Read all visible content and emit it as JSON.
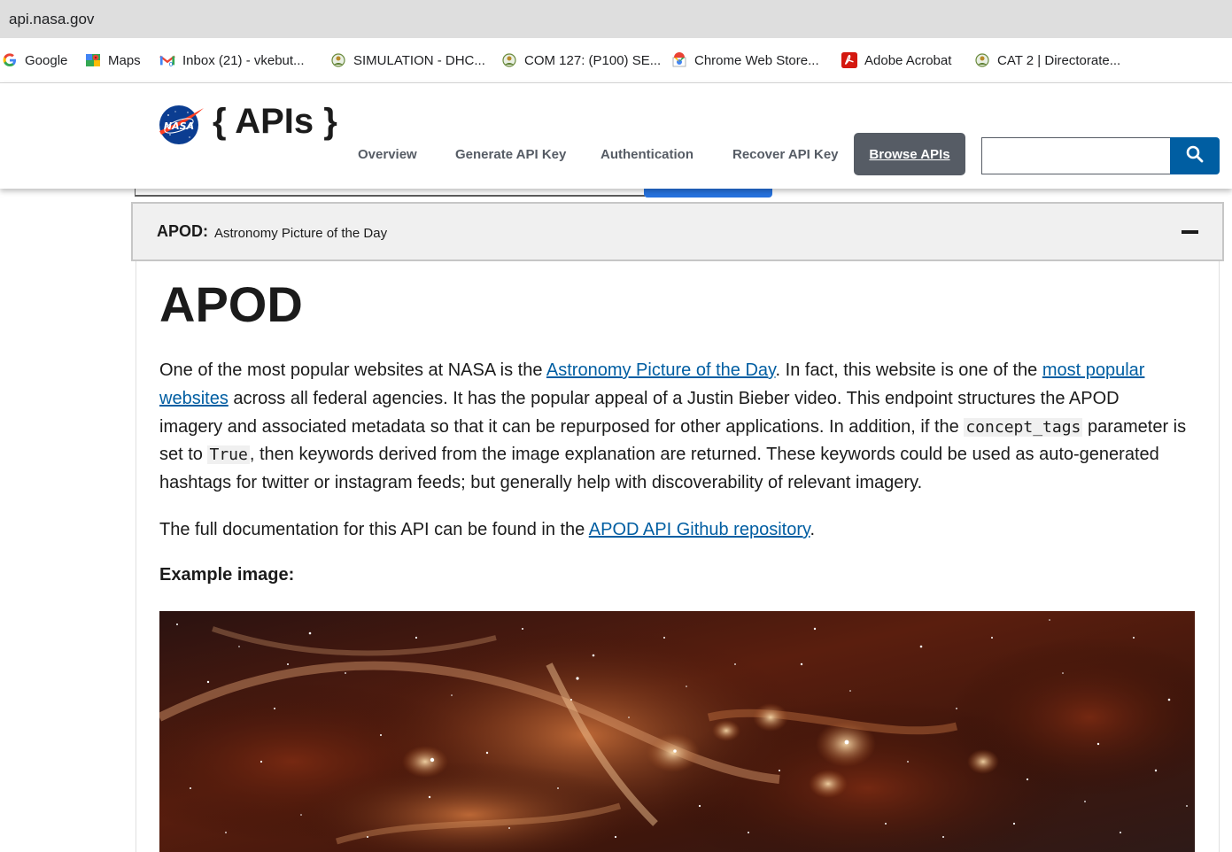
{
  "browser": {
    "url": "api.nasa.gov",
    "bookmarks": [
      {
        "label": "Google",
        "icon": "google-icon"
      },
      {
        "label": "Maps",
        "icon": "maps-icon"
      },
      {
        "label": "Inbox (21) - vkebut...",
        "icon": "gmail-icon"
      },
      {
        "label": "SIMULATION - DHC...",
        "icon": "site-badge-icon"
      },
      {
        "label": "COM 127: (P100) SE...",
        "icon": "site-badge-icon"
      },
      {
        "label": "Chrome Web Store...",
        "icon": "chrome-web-store-icon"
      },
      {
        "label": "Adobe Acrobat",
        "icon": "adobe-acrobat-icon"
      },
      {
        "label": "CAT 2 | Directorate...",
        "icon": "site-badge-icon"
      }
    ]
  },
  "header": {
    "title": "{ APIs }",
    "logo_text": "NASA",
    "nav": [
      "Overview",
      "Generate API Key",
      "Authentication",
      "Recover API Key"
    ],
    "browse_label": "Browse APIs",
    "search_value": ""
  },
  "accordion": {
    "label": "APOD:",
    "sublabel": "Astronomy Picture of the Day"
  },
  "article": {
    "heading": "APOD",
    "p1": {
      "t1": "One of the most popular websites at NASA is the ",
      "link1": "Astronomy Picture of the Day",
      "t2": ". In fact, this website is one of the ",
      "link2": "most popular websites",
      "t3": " across all federal agencies. It has the popular appeal of a Justin Bieber video. This endpoint structures the APOD imagery and associated metadata so that it can be repurposed for other applications. In addition, if the ",
      "code1": "concept_tags",
      "t4": " parameter is set to ",
      "code2": "True",
      "t5": ", then keywords derived from the image explanation are returned. These keywords could be used as auto-generated hashtags for twitter or instagram feeds; but generally help with discoverability of relevant imagery."
    },
    "p2": {
      "t1": "The full documentation for this API can be found in the ",
      "link": "APOD API Github repository",
      "t2": "."
    },
    "example_label": "Example image:"
  },
  "colors": {
    "link": "#005ea2",
    "browse_bg": "#565c65",
    "search_btn": "#005ea2",
    "nasa_blue": "#0b3d91",
    "nasa_red": "#fc3d21"
  }
}
